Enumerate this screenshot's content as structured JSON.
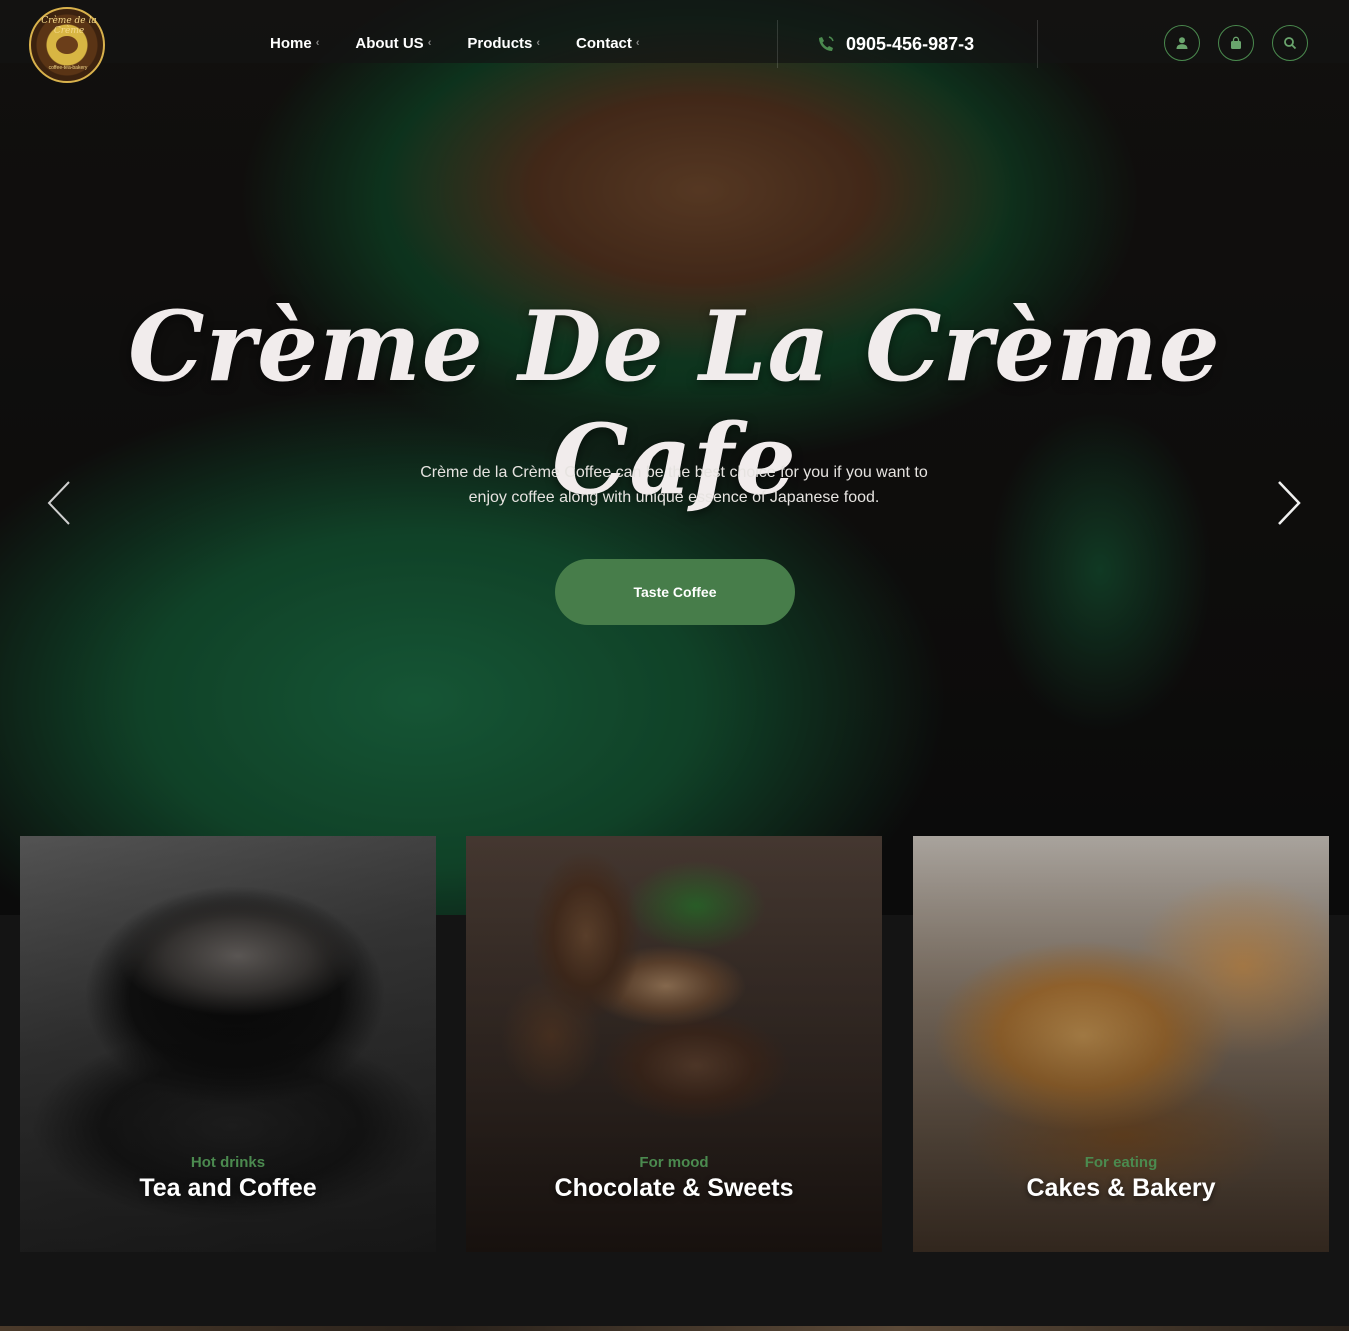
{
  "brand": {
    "logo_text": "Crème de la Crème",
    "logo_sub": "coffee-tea-bakery"
  },
  "nav": {
    "items": [
      {
        "label": "Home"
      },
      {
        "label": "About US"
      },
      {
        "label": "Products"
      },
      {
        "label": "Contact"
      }
    ]
  },
  "contact": {
    "phone": "0905-456-987-3"
  },
  "header_icons": [
    "user-icon",
    "shopping-bag-icon",
    "search-icon"
  ],
  "hero": {
    "title": "Crème De La Crème Cafe",
    "description": "Crème de la Crème Coffee can be the best choice for you if you want to enjoy coffee along with unique essence of Japanese food.",
    "cta_label": "Taste Coffee"
  },
  "categories": [
    {
      "subtitle": "Hot drinks",
      "title": "Tea and Coffee"
    },
    {
      "subtitle": "For mood",
      "title": "Chocolate & Sweets"
    },
    {
      "subtitle": "For eating",
      "title": "Cakes & Bakery"
    }
  ],
  "colors": {
    "accent": "#477d4a",
    "accent_text": "#4b8a4f",
    "background": "#141414"
  }
}
